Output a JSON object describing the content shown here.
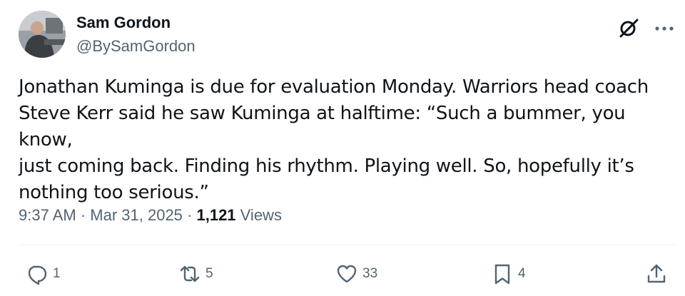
{
  "author": {
    "name": "Sam Gordon",
    "handle": "@BySamGordon"
  },
  "tweet": {
    "text": "Jonathan Kuminga is due for evaluation Monday. Warriors head coach\nSteve Kerr said he saw Kuminga at halftime: “Such a bummer, you know,\njust coming back. Finding his rhythm. Playing well. So, hopefully it’s\nnothing too serious.”",
    "time": "9:37 AM",
    "separator": " · ",
    "date": "Mar 31, 2025",
    "views_count": "1,121",
    "views_label": " Views"
  },
  "actions": {
    "replies": "1",
    "reposts": "5",
    "likes": "33",
    "bookmarks": "4"
  },
  "colors": {
    "text": "#0f1419",
    "secondary": "#536471",
    "divider": "#eff3f4"
  },
  "icons": [
    "grok-icon",
    "more-icon",
    "reply-icon",
    "repost-icon",
    "like-icon",
    "bookmark-icon",
    "share-icon"
  ]
}
